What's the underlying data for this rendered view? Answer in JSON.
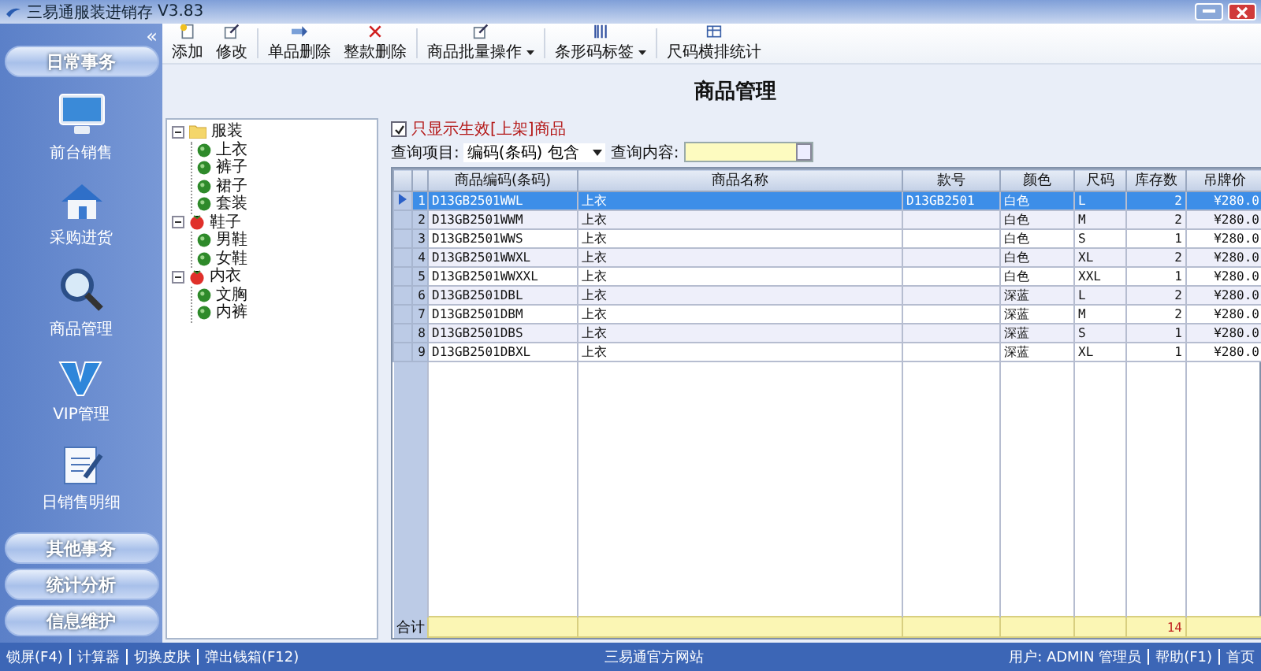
{
  "window": {
    "title": "三易通服装进销存",
    "version": "V3.83"
  },
  "sidebar": {
    "collapse": "«",
    "sections": [
      {
        "label": "日常事务",
        "items": [
          {
            "kind": "monitor",
            "label": "前台销售"
          },
          {
            "kind": "house",
            "label": "采购进货"
          },
          {
            "kind": "magnifier",
            "label": "商品管理"
          },
          {
            "kind": "vip",
            "label": "VIP管理"
          },
          {
            "kind": "notepad",
            "label": "日销售明细"
          }
        ]
      },
      {
        "label": "其他事务"
      },
      {
        "label": "统计分析"
      },
      {
        "label": "信息维护"
      }
    ]
  },
  "toolbar": [
    {
      "kind": "add",
      "label": "添加",
      "dropdown": false
    },
    {
      "kind": "edit",
      "label": "修改",
      "dropdown": false
    },
    {
      "kind": "delete-one",
      "label": "单品删除",
      "dropdown": false
    },
    {
      "kind": "delete-all",
      "label": "整款删除",
      "dropdown": false
    },
    {
      "kind": "batch",
      "label": "商品批量操作",
      "dropdown": true
    },
    {
      "kind": "barcode",
      "label": "条形码标签",
      "dropdown": true
    },
    {
      "kind": "grid",
      "label": "尺码横排统计",
      "dropdown": false
    }
  ],
  "heading": "商品管理",
  "tree": [
    {
      "kind": "folder",
      "label": "服装",
      "expanded": true,
      "children": [
        {
          "kind": "leaf",
          "label": "上衣"
        },
        {
          "kind": "leaf",
          "label": "裤子"
        },
        {
          "kind": "leaf",
          "label": "裙子"
        },
        {
          "kind": "leaf",
          "label": "套装"
        }
      ]
    },
    {
      "kind": "group",
      "label": "鞋子",
      "expanded": true,
      "children": [
        {
          "kind": "leaf",
          "label": "男鞋"
        },
        {
          "kind": "leaf",
          "label": "女鞋"
        }
      ]
    },
    {
      "kind": "group",
      "label": "内衣",
      "expanded": true,
      "children": [
        {
          "kind": "leaf",
          "label": "文胸"
        },
        {
          "kind": "leaf",
          "label": "内裤"
        }
      ]
    }
  ],
  "filter": {
    "checkbox": {
      "label": "只显示生效[上架]商品",
      "checked": true
    },
    "query_item_label": "查询项目:",
    "query_item_value": "编码(条码) 包含",
    "query_content_label": "查询内容:"
  },
  "table": {
    "columns": [
      "商品编码(条码)",
      "商品名称",
      "款号",
      "颜色",
      "尺码",
      "库存数",
      "吊牌价"
    ],
    "rows": [
      {
        "num": "1",
        "cells": [
          "D13GB2501WWL",
          "上衣",
          "D13GB2501",
          "白色",
          "L",
          "2",
          "¥280.0"
        ],
        "selected": true
      },
      {
        "num": "2",
        "cells": [
          "D13GB2501WWM",
          "上衣",
          "",
          "白色",
          "M",
          "2",
          "¥280.0"
        ],
        "selected": false
      },
      {
        "num": "3",
        "cells": [
          "D13GB2501WWS",
          "上衣",
          "",
          "白色",
          "S",
          "1",
          "¥280.0"
        ],
        "selected": false
      },
      {
        "num": "4",
        "cells": [
          "D13GB2501WWXL",
          "上衣",
          "",
          "白色",
          "XL",
          "2",
          "¥280.0"
        ],
        "selected": false
      },
      {
        "num": "5",
        "cells": [
          "D13GB2501WWXXL",
          "上衣",
          "",
          "白色",
          "XXL",
          "1",
          "¥280.0"
        ],
        "selected": false
      },
      {
        "num": "6",
        "cells": [
          "D13GB2501DBL",
          "上衣",
          "",
          "深蓝",
          "L",
          "2",
          "¥280.0"
        ],
        "selected": false
      },
      {
        "num": "7",
        "cells": [
          "D13GB2501DBM",
          "上衣",
          "",
          "深蓝",
          "M",
          "2",
          "¥280.0"
        ],
        "selected": false
      },
      {
        "num": "8",
        "cells": [
          "D13GB2501DBS",
          "上衣",
          "",
          "深蓝",
          "S",
          "1",
          "¥280.0"
        ],
        "selected": false
      },
      {
        "num": "9",
        "cells": [
          "D13GB2501DBXL",
          "上衣",
          "",
          "深蓝",
          "XL",
          "1",
          "¥280.0"
        ],
        "selected": false
      }
    ],
    "footer": {
      "label": "合计",
      "stock_total": "14"
    }
  },
  "status_bar": {
    "left": [
      "锁屏(F4)",
      "计算器",
      "切换皮肤",
      "弹出钱箱(F12)"
    ],
    "center": "三易通官方网站",
    "user": "用户: ADMIN 管理员",
    "right": [
      "帮助(F1)",
      "首页"
    ]
  }
}
